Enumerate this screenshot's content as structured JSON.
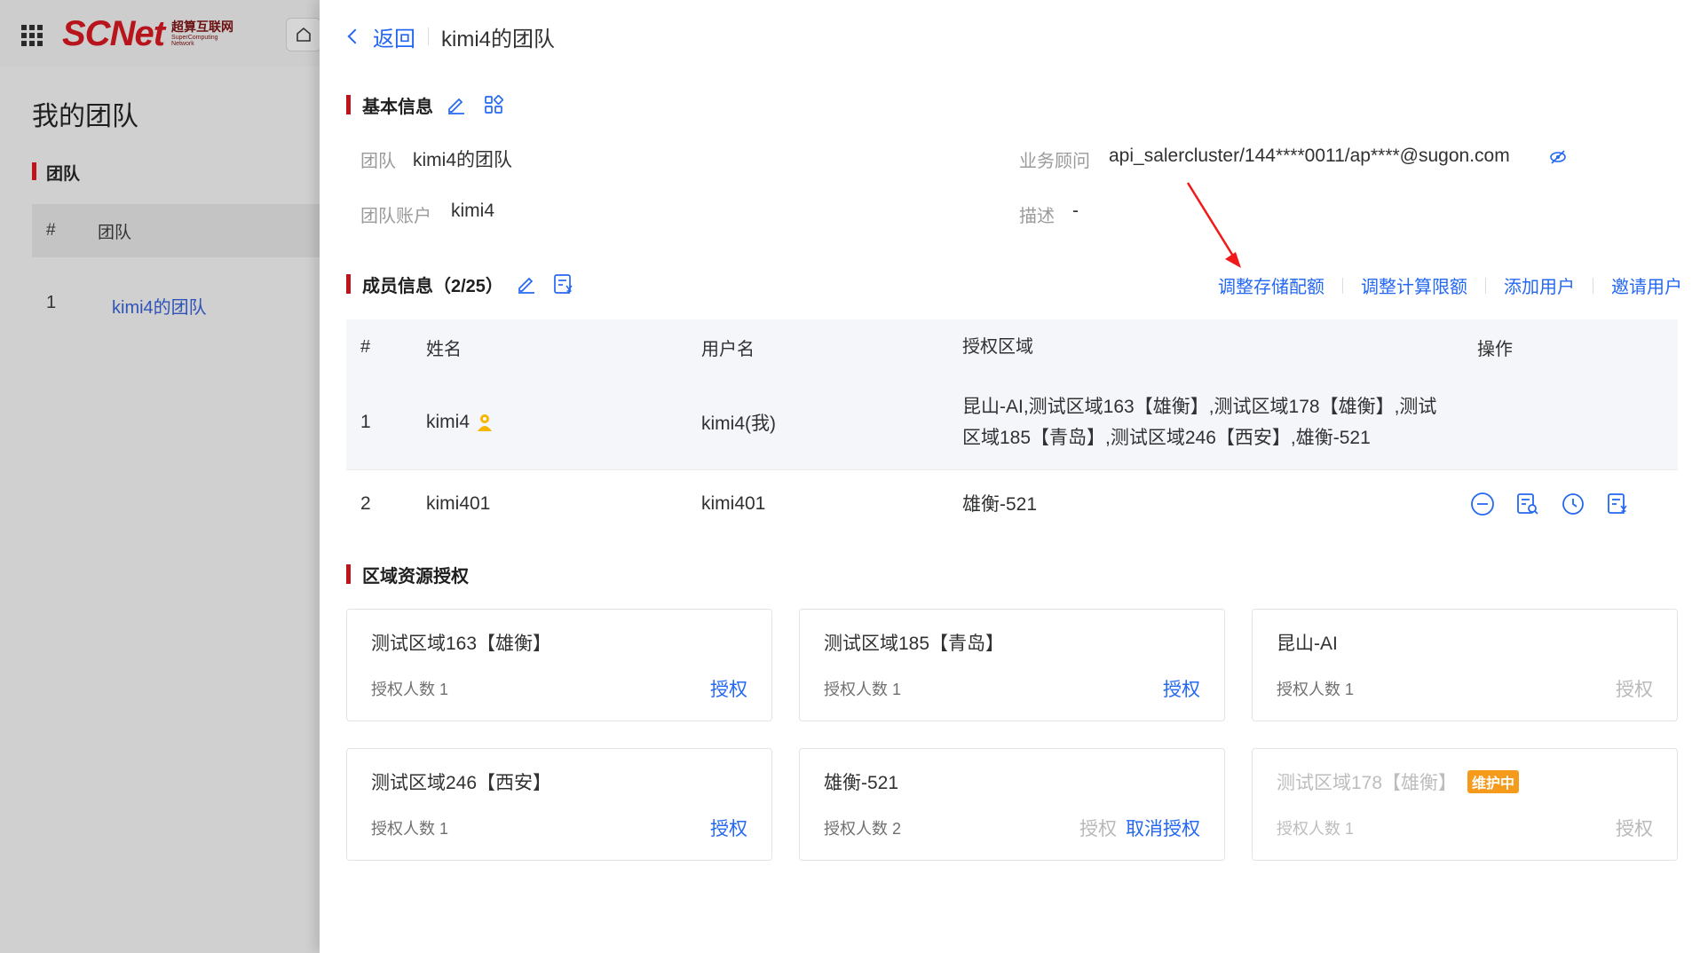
{
  "background": {
    "logo": {
      "main": "SCNet",
      "sub_cn": "超算互联网",
      "sub_en": "SuperComputing Network"
    },
    "page_title": "我的团队",
    "section": "团队",
    "table_head": {
      "idx": "#",
      "team": "团队"
    },
    "rows": [
      {
        "idx": "1",
        "team": "kimi4的团队"
      }
    ]
  },
  "drawer": {
    "back_label": "返回",
    "title": "kimi4的团队",
    "basic": {
      "title": "基本信息",
      "team_label": "团队",
      "team_value": "kimi4的团队",
      "account_label": "团队账户",
      "account_value": "kimi4",
      "advisor_label": "业务顾问",
      "advisor_value": "api_salercluster/144****0011/ap****@sugon.com",
      "desc_label": "描述",
      "desc_value": "-"
    },
    "members": {
      "title": "成员信息（2/25）",
      "actions": [
        "调整存储配额",
        "调整计算限额",
        "添加用户",
        "邀请用户"
      ],
      "columns": {
        "idx": "#",
        "name": "姓名",
        "username": "用户名",
        "region": "授权区域",
        "ops": "操作"
      },
      "rows": [
        {
          "idx": "1",
          "name": "kimi4",
          "username": "kimi4(我)",
          "region": "昆山-AI,测试区域163【雄衡】,测试区域178【雄衡】,测试区域185【青岛】,测试区域246【西安】,雄衡-521"
        },
        {
          "idx": "2",
          "name": "kimi401",
          "username": "kimi401",
          "region": "雄衡-521"
        }
      ]
    },
    "regions": {
      "title": "区域资源授权",
      "cards": [
        {
          "name": "测试区域163【雄衡】",
          "count": "授权人数 1",
          "auth": "授权"
        },
        {
          "name": "测试区域185【青岛】",
          "count": "授权人数 1",
          "auth": "授权"
        },
        {
          "name": "昆山-AI",
          "count": "授权人数 1",
          "auth": "授权"
        },
        {
          "name": "测试区域246【西安】",
          "count": "授权人数 1",
          "auth": "授权"
        },
        {
          "name": "雄衡-521",
          "count": "授权人数 2",
          "auth": "授权",
          "revoke": "取消授权"
        },
        {
          "name": "测试区域178【雄衡】",
          "count": "授权人数 1",
          "auth": "授权",
          "badge": "维护中"
        }
      ]
    }
  },
  "colors": {
    "accent": "#2468f2",
    "brand_red": "#c0141c",
    "badge_orange": "#f59a1b"
  }
}
